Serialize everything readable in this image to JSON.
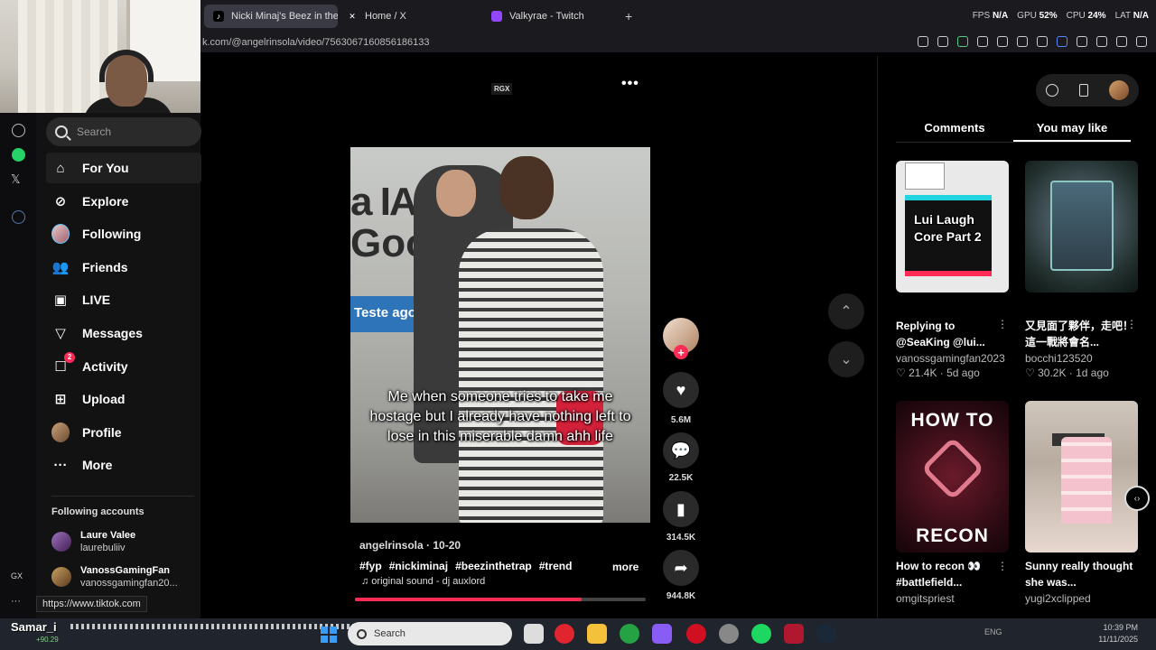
{
  "browser": {
    "tabs": [
      {
        "label": "Nicki Minaj's Beez in the",
        "icon": "tiktok-icon",
        "active": true
      },
      {
        "label": "Home / X",
        "icon": "x-icon",
        "active": false
      },
      {
        "label": "Valkyrae - Twitch",
        "icon": "twitch-icon",
        "active": false
      }
    ],
    "new_tab": "+",
    "url": "k.com/@angelrinsola/video/7563067160856186133",
    "stats": {
      "fps_label": "FPS",
      "fps": "N/A",
      "gpu_label": "GPU",
      "gpu": "52%",
      "cpu_label": "CPU",
      "cpu": "24%",
      "lat_label": "LAT",
      "lat": "N/A"
    }
  },
  "opera_sidebar": {
    "bottom_label": "GX",
    "more": "···"
  },
  "sidebar": {
    "search_placeholder": "Search",
    "nav": [
      {
        "label": "For You",
        "icon": "home-icon",
        "active": true
      },
      {
        "label": "Explore",
        "icon": "compass-icon"
      },
      {
        "label": "Following",
        "icon": "following-avatar-icon"
      },
      {
        "label": "Friends",
        "icon": "friends-icon"
      },
      {
        "label": "LIVE",
        "icon": "live-icon"
      },
      {
        "label": "Messages",
        "icon": "messages-icon"
      },
      {
        "label": "Activity",
        "icon": "activity-icon",
        "badge": "2"
      },
      {
        "label": "Upload",
        "icon": "upload-icon"
      },
      {
        "label": "Profile",
        "icon": "profile-avatar-icon"
      },
      {
        "label": "More",
        "icon": "more-dots-icon"
      }
    ],
    "following_title": "Following accounts",
    "accounts": [
      {
        "name": "Laure Valee",
        "handle": "laurebuliiv"
      },
      {
        "name": "VanossGamingFan",
        "handle": "vanossgamingfan20..."
      }
    ]
  },
  "status_url": "https://www.tiktok.com",
  "video": {
    "rgx_label": "RGX",
    "more": "•••",
    "sign_text_1": "a IA do",
    "sign_text_2": "Goo",
    "blue_sign": "Teste agora",
    "caption": "Me when someone tries to take me hostage but I already have nothing left to lose in this miserable damn ahh life",
    "author": "angelrinsola · 10-20",
    "hashtags": [
      "#fyp",
      "#nickiminaj",
      "#beezinthetrap",
      "#trend"
    ],
    "more_label": "more",
    "sound": "♫  original sound - dj auxlord",
    "progress": 0.78
  },
  "actions": {
    "likes": "5.6M",
    "comments": "22.5K",
    "saves": "314.5K",
    "shares": "944.8K"
  },
  "right_panel": {
    "tabs": [
      "Comments",
      "You may like"
    ],
    "cards": [
      {
        "thumb_text": "Lui Laugh Core Part 2",
        "title": "Replying to @SeaKing @lui...",
        "author": "vanossgamingfan2023",
        "stats": "♡ 21.4K · 5d ago"
      },
      {
        "thumb_text": "",
        "title": "又見面了夥伴，走吧！這一戰將會名...",
        "author": "bocchi123520",
        "stats": "♡ 30.2K · 1d ago"
      },
      {
        "thumb_text_top": "HOW TO",
        "thumb_text_bottom": "RECON",
        "title": "How to recon 👀 #battlefield...",
        "author": "omgitspriest",
        "stats": ""
      },
      {
        "thumb_text": "",
        "title": "Sunny really thought she was...",
        "author": "yugi2xclipped",
        "stats": ""
      }
    ]
  },
  "taskbar": {
    "stream_name": "Samar_i",
    "stream_sub": "+90.29",
    "search_placeholder": "Search",
    "tray_time": "10:39 PM",
    "tray_date": "11/11/2025",
    "tray_lang": "ENG"
  },
  "colors": {
    "accent": "#fe2c55",
    "bg": "#000000",
    "sidebar": "#121212"
  }
}
